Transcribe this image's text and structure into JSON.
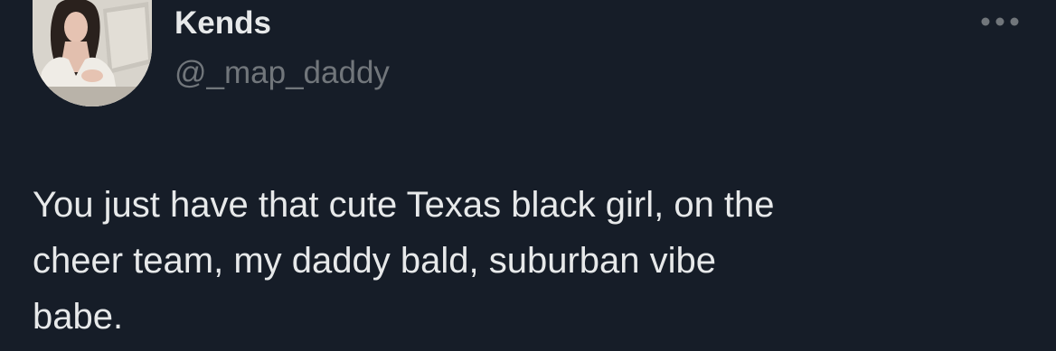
{
  "author": {
    "display_name": "Kends",
    "handle": "@_map_daddy",
    "avatar_icon": "profile-photo"
  },
  "actions": {
    "more_icon": "more-horizontal-icon"
  },
  "tweet": {
    "text": "You just have that cute Texas black girl, on the\ncheer team, my daddy bald, suburban vibe\nbabe."
  },
  "colors": {
    "background": "#161d28",
    "primary_text": "#e7e9ea",
    "secondary_text": "#71767b"
  }
}
